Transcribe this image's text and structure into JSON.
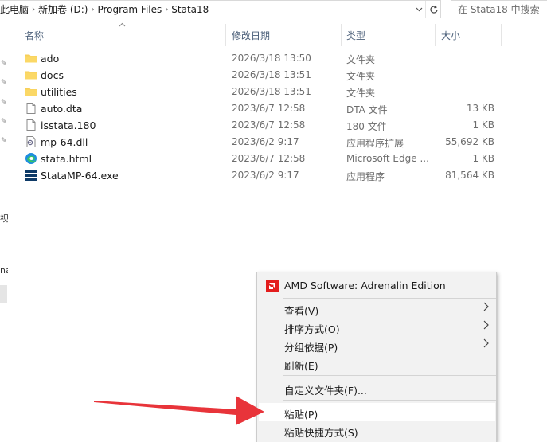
{
  "address_bar": {
    "crumbs": [
      "此电脑",
      "新加卷 (D:)",
      "Program Files",
      "Stata18"
    ],
    "search_placeholder": "在 Stata18 中搜索"
  },
  "nav_pane": {
    "clipped_labels": [
      "视",
      "na"
    ]
  },
  "columns": {
    "name": "名称",
    "modified": "修改日期",
    "type": "类型",
    "size": "大小"
  },
  "files": [
    {
      "name": "ado",
      "modified": "2026/3/18 13:50",
      "type": "文件夹",
      "size": "",
      "icon": "folder-icon"
    },
    {
      "name": "docs",
      "modified": "2026/3/18 13:51",
      "type": "文件夹",
      "size": "",
      "icon": "folder-icon"
    },
    {
      "name": "utilities",
      "modified": "2026/3/18 13:51",
      "type": "文件夹",
      "size": "",
      "icon": "folder-icon"
    },
    {
      "name": "auto.dta",
      "modified": "2023/6/7 12:58",
      "type": "DTA 文件",
      "size": "13 KB",
      "icon": "file-icon"
    },
    {
      "name": "isstata.180",
      "modified": "2023/6/7 12:58",
      "type": "180 文件",
      "size": "1 KB",
      "icon": "file-icon"
    },
    {
      "name": "mp-64.dll",
      "modified": "2023/6/2 9:17",
      "type": "应用程序扩展",
      "size": "55,692 KB",
      "icon": "dll-icon"
    },
    {
      "name": "stata.html",
      "modified": "2023/6/7 12:58",
      "type": "Microsoft Edge ...",
      "size": "1 KB",
      "icon": "edge-icon"
    },
    {
      "name": "StataMP-64.exe",
      "modified": "2023/6/2 9:17",
      "type": "应用程序",
      "size": "81,564 KB",
      "icon": "stata-app-icon"
    }
  ],
  "context_menu": {
    "amd": "AMD Software: Adrenalin Edition",
    "view": "查看(V)",
    "sort_by": "排序方式(O)",
    "group_by": "分组依据(P)",
    "refresh": "刷新(E)",
    "customize": "自定义文件夹(F)...",
    "paste": "粘贴(P)",
    "paste_shortcut": "粘贴快捷方式(S)"
  },
  "colors": {
    "accent_red": "#e8343a",
    "folder_yellow": "#f7cf5a",
    "header_text": "#4c607a"
  }
}
